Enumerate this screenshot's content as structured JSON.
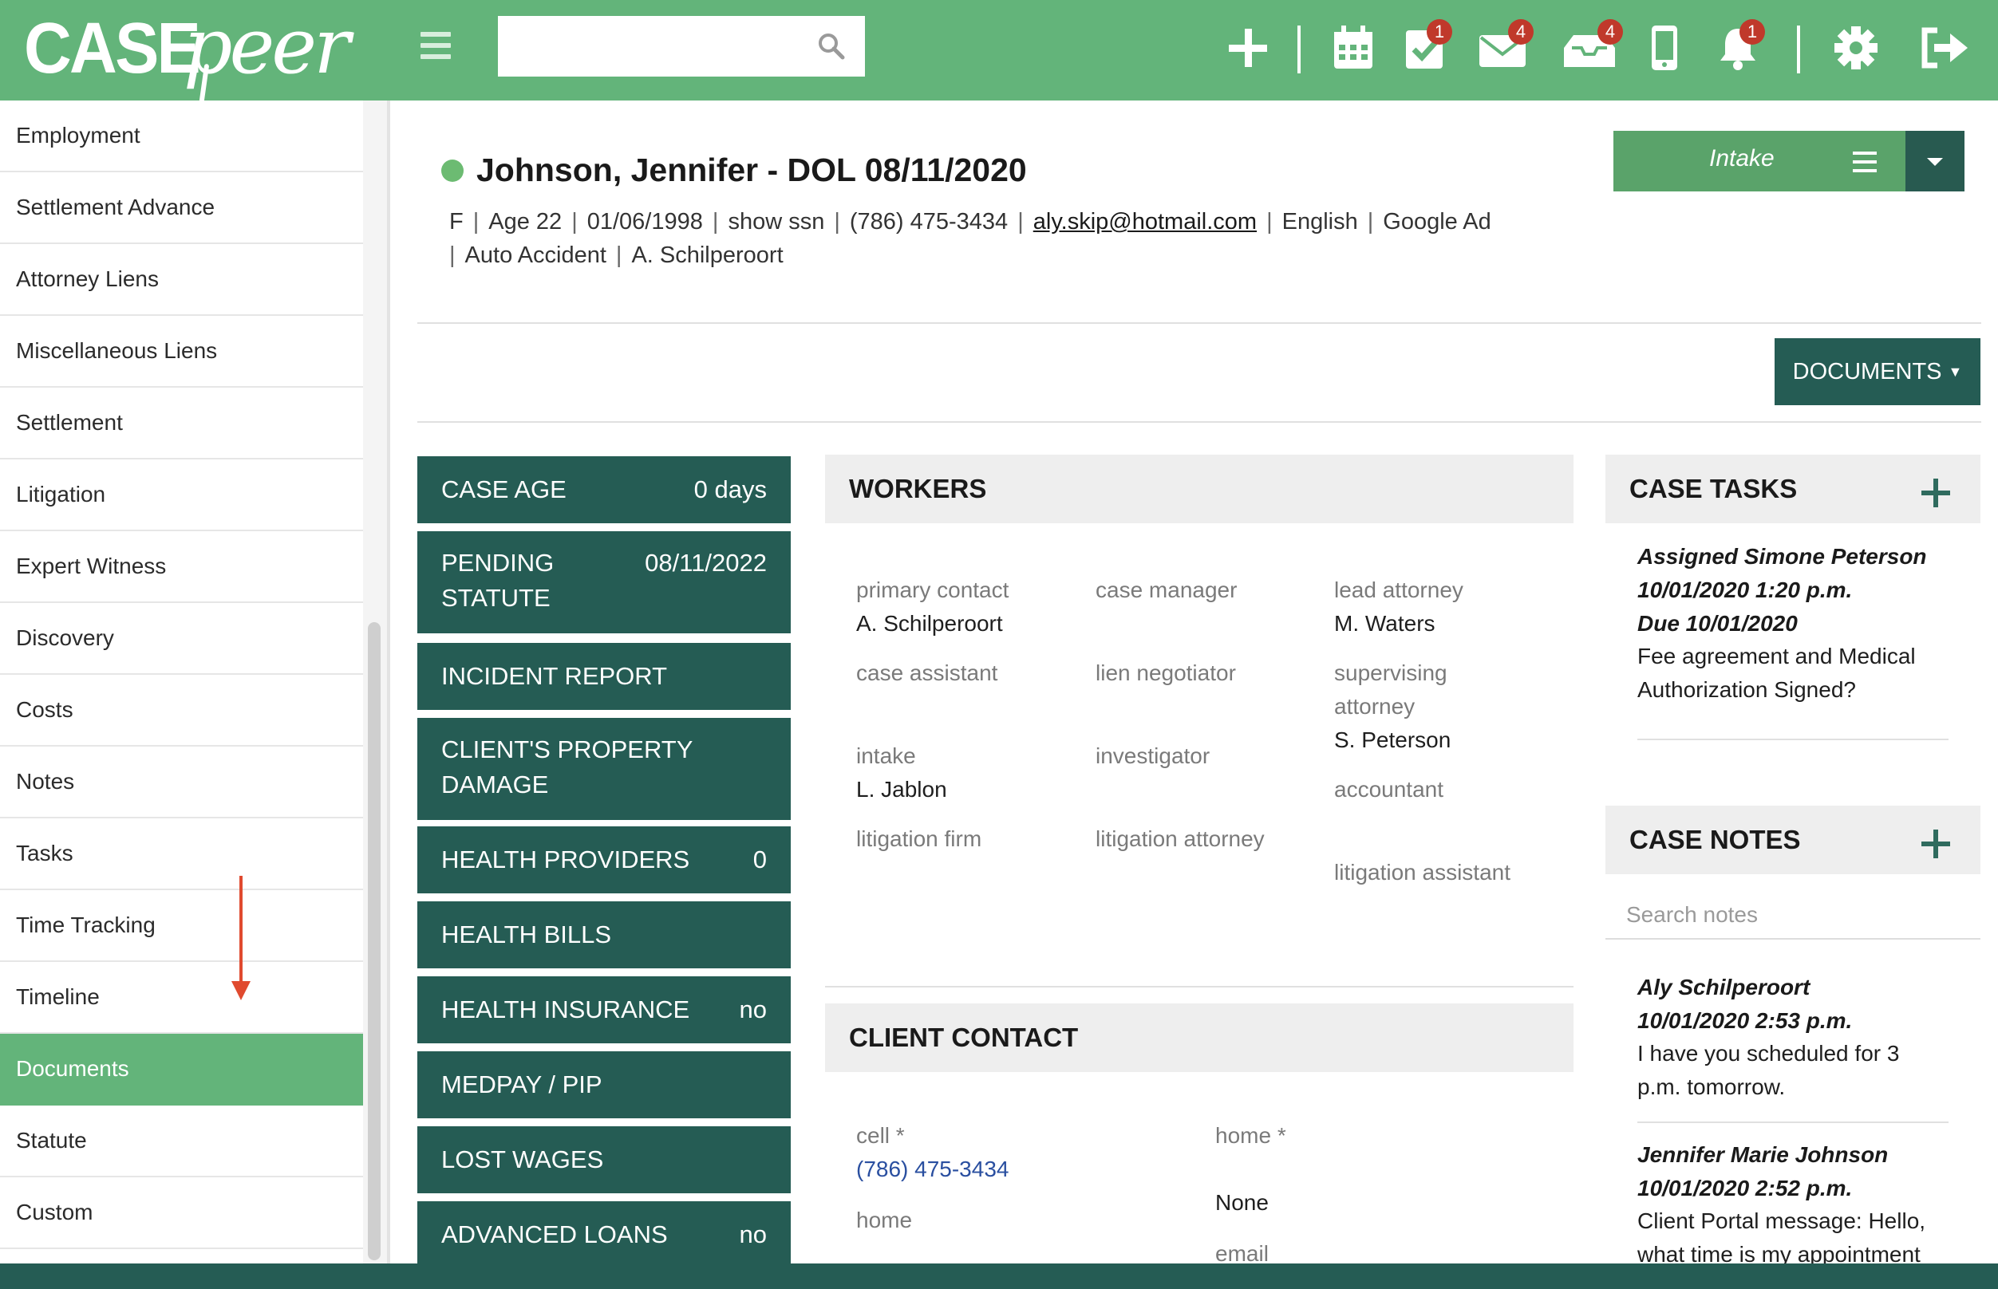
{
  "brand": {
    "case": "CASE",
    "peer": "peer"
  },
  "topbar": {
    "search_placeholder": "",
    "badges": {
      "tasks": "1",
      "mail": "4",
      "inbox": "4",
      "notifications": "1"
    },
    "colors": {
      "bar": "#63b47a",
      "badge": "#c0392b"
    }
  },
  "sidebar": {
    "items": [
      {
        "label": "Employment",
        "active": false
      },
      {
        "label": "Settlement Advance",
        "active": false
      },
      {
        "label": "Attorney Liens",
        "active": false
      },
      {
        "label": "Miscellaneous Liens",
        "active": false
      },
      {
        "label": "Settlement",
        "active": false
      },
      {
        "label": "Litigation",
        "active": false
      },
      {
        "label": "Expert Witness",
        "active": false
      },
      {
        "label": "Discovery",
        "active": false
      },
      {
        "label": "Costs",
        "active": false
      },
      {
        "label": "Notes",
        "active": false
      },
      {
        "label": "Tasks",
        "active": false
      },
      {
        "label": "Time Tracking",
        "active": false
      },
      {
        "label": "Timeline",
        "active": false
      },
      {
        "label": "Documents",
        "active": true
      },
      {
        "label": "Statute",
        "active": false
      },
      {
        "label": "Custom",
        "active": false
      }
    ]
  },
  "header": {
    "title": "Johnson, Jennifer - DOL 08/11/2020",
    "sex": "F",
    "age": "Age 22",
    "dob": "01/06/1998",
    "ssn": "show ssn",
    "phone": "(786) 475-3434",
    "email": "aly.skip@hotmail.com",
    "language": "English",
    "source": "Google Ad",
    "case_type": "Auto Accident",
    "attorney": "A. Schilperoort",
    "intake_label": "Intake",
    "documents_label": "DOCUMENTS"
  },
  "tiles": [
    {
      "label": "CASE AGE",
      "value": "0 days"
    },
    {
      "label": "PENDING",
      "label2": "STATUTE",
      "value": "08/11/2022"
    },
    {
      "label": "INCIDENT REPORT",
      "value": ""
    },
    {
      "label": "CLIENT'S PROPERTY",
      "label2": "DAMAGE",
      "value": ""
    },
    {
      "label": "HEALTH PROVIDERS",
      "value": "0"
    },
    {
      "label": "HEALTH BILLS",
      "value": ""
    },
    {
      "label": "HEALTH INSURANCE",
      "value": "no"
    },
    {
      "label": "MEDPAY / PIP",
      "value": ""
    },
    {
      "label": "LOST WAGES",
      "value": ""
    },
    {
      "label": "ADVANCED LOANS",
      "value": "no"
    }
  ],
  "workers": {
    "title": "WORKERS",
    "primary_contact": {
      "label": "primary contact",
      "value": "A. Schilperoort"
    },
    "case_manager": {
      "label": "case manager"
    },
    "lead_attorney": {
      "label": "lead attorney",
      "value": "M. Waters"
    },
    "case_assistant": {
      "label": "case assistant"
    },
    "lien_negotiator": {
      "label": "lien negotiator"
    },
    "supervising_attorney": {
      "label1": "supervising",
      "label2": "attorney",
      "value": "S. Peterson"
    },
    "intake": {
      "label": "intake",
      "value": "L. Jablon"
    },
    "investigator": {
      "label": "investigator"
    },
    "accountant": {
      "label": "accountant"
    },
    "litigation_firm": {
      "label": "litigation firm"
    },
    "litigation_attorney": {
      "label": "litigation attorney"
    },
    "litigation_assistant": {
      "label": "litigation assistant"
    }
  },
  "client_contact": {
    "title": "CLIENT CONTACT",
    "cell_label": "cell *",
    "cell_value": "(786) 475-3434",
    "home_star_label": "home *",
    "home_star_value": "None",
    "home_label": "home",
    "email_label": "email"
  },
  "case_tasks": {
    "title": "CASE TASKS",
    "items": [
      {
        "assigned": "Assigned Simone Peterson",
        "date": "10/01/2020 1:20 p.m.",
        "due": "Due 10/01/2020",
        "text1": "Fee agreement and Medical",
        "text2": "Authorization Signed?"
      }
    ]
  },
  "case_notes": {
    "title": "CASE NOTES",
    "search_placeholder": "Search notes",
    "items": [
      {
        "author": "Aly Schilperoort",
        "date": "10/01/2020 2:53 p.m.",
        "text1": "I have you scheduled for 3",
        "text2": "p.m. tomorrow."
      },
      {
        "author": "Jennifer Marie Johnson",
        "date": "10/01/2020 2:52 p.m.",
        "text1": "Client Portal message: Hello,",
        "text2": "what time is my appointment"
      }
    ]
  }
}
